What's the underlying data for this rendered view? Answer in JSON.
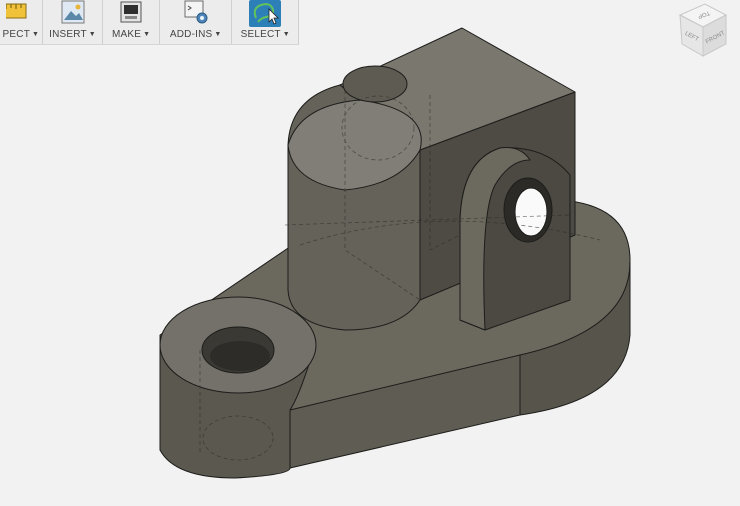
{
  "toolbar": {
    "groups": [
      {
        "label": "PECT",
        "icon": "inspect-ruler-icon"
      },
      {
        "label": "INSERT",
        "icon": "insert-image-icon"
      },
      {
        "label": "MAKE",
        "icon": "make-3d-print-icon"
      },
      {
        "label": "ADD-INS",
        "icon": "add-ins-script-gear-icon"
      },
      {
        "label": "SELECT",
        "icon": "select-lasso-cursor-icon",
        "active": true
      }
    ]
  },
  "viewcube": {
    "faces": {
      "top": "TOP",
      "left": "LEFT",
      "front": "FRONT"
    }
  },
  "colors": {
    "background": "#f2f2f2",
    "model_body": "#6e6b60",
    "select_active": "#2d7fb8"
  }
}
